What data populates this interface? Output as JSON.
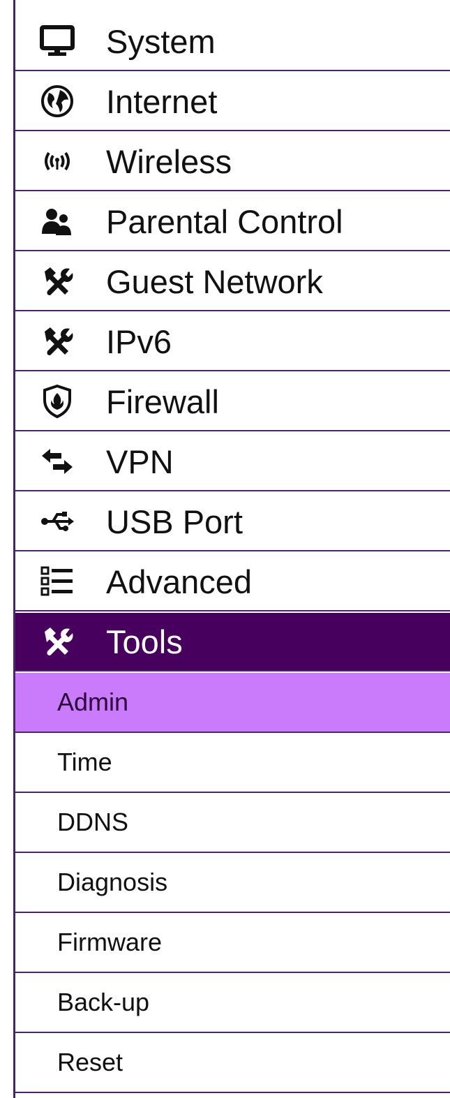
{
  "menu": {
    "items": [
      {
        "label": "System",
        "icon": "monitor-icon"
      },
      {
        "label": "Internet",
        "icon": "globe-icon"
      },
      {
        "label": "Wireless",
        "icon": "wireless-signal-icon"
      },
      {
        "label": "Parental Control",
        "icon": "users-icon"
      },
      {
        "label": "Guest Network",
        "icon": "tools-icon"
      },
      {
        "label": "IPv6",
        "icon": "tools-icon"
      },
      {
        "label": "Firewall",
        "icon": "firewall-shield-icon"
      },
      {
        "label": "VPN",
        "icon": "arrows-exchange-icon"
      },
      {
        "label": "USB Port",
        "icon": "usb-icon"
      },
      {
        "label": "Advanced",
        "icon": "list-icon"
      },
      {
        "label": "Tools",
        "icon": "tools-icon",
        "active": true
      }
    ],
    "tools_submenu": [
      {
        "label": "Admin",
        "selected": true
      },
      {
        "label": "Time"
      },
      {
        "label": "DDNS"
      },
      {
        "label": "Diagnosis"
      },
      {
        "label": "Firmware"
      },
      {
        "label": "Back-up"
      },
      {
        "label": "Reset"
      }
    ]
  },
  "colors": {
    "border": "#4b2270",
    "active_bg": "#47005e",
    "selected_bg": "#c97bfb"
  }
}
